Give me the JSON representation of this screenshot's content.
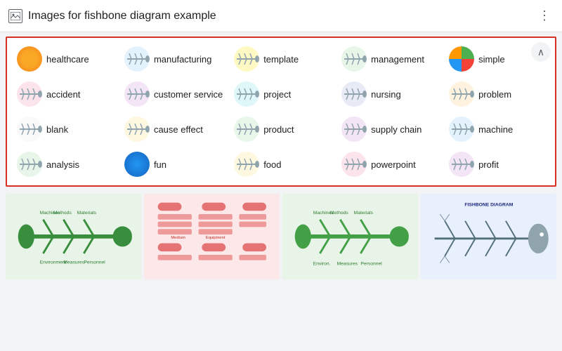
{
  "header": {
    "title": "Images for fishbone diagram example",
    "more_icon": "⋮",
    "collapse_icon": "∧"
  },
  "chips": [
    {
      "id": "healthcare",
      "label": "healthcare",
      "thumb_class": "thumb-healthcare"
    },
    {
      "id": "manufacturing",
      "label": "manufacturing",
      "thumb_class": "thumb-manufacturing"
    },
    {
      "id": "template",
      "label": "template",
      "thumb_class": "thumb-template"
    },
    {
      "id": "management",
      "label": "management",
      "thumb_class": "thumb-management"
    },
    {
      "id": "simple",
      "label": "simple",
      "thumb_class": "thumb-simple"
    },
    {
      "id": "accident",
      "label": "accident",
      "thumb_class": "thumb-accident"
    },
    {
      "id": "customer-service",
      "label": "customer service",
      "thumb_class": "thumb-customer"
    },
    {
      "id": "project",
      "label": "project",
      "thumb_class": "thumb-project"
    },
    {
      "id": "nursing",
      "label": "nursing",
      "thumb_class": "thumb-nursing"
    },
    {
      "id": "problem",
      "label": "problem",
      "thumb_class": "thumb-problem"
    },
    {
      "id": "blank",
      "label": "blank",
      "thumb_class": "thumb-blank"
    },
    {
      "id": "cause-effect",
      "label": "cause effect",
      "thumb_class": "thumb-cause"
    },
    {
      "id": "product",
      "label": "product",
      "thumb_class": "thumb-product"
    },
    {
      "id": "supply-chain",
      "label": "supply chain",
      "thumb_class": "thumb-supply"
    },
    {
      "id": "machine",
      "label": "machine",
      "thumb_class": "thumb-machine"
    },
    {
      "id": "analysis",
      "label": "analysis",
      "thumb_class": "thumb-analysis"
    },
    {
      "id": "fun",
      "label": "fun",
      "thumb_class": "thumb-fun"
    },
    {
      "id": "food",
      "label": "food",
      "thumb_class": "thumb-food"
    },
    {
      "id": "powerpoint",
      "label": "powerpoint",
      "thumb_class": "thumb-powerpoint"
    },
    {
      "id": "profit",
      "label": "profit",
      "thumb_class": "thumb-profit"
    }
  ],
  "strip_images": [
    {
      "id": "strip1",
      "type": "green-fishbone"
    },
    {
      "id": "strip2",
      "type": "red-boxes"
    },
    {
      "id": "strip3",
      "type": "green-fishbone2"
    },
    {
      "id": "strip4",
      "type": "fishbone-diagram"
    }
  ],
  "colors": {
    "border_red": "#d93025",
    "header_bg": "#ffffff",
    "chip_hover": "#f1f3f4"
  }
}
